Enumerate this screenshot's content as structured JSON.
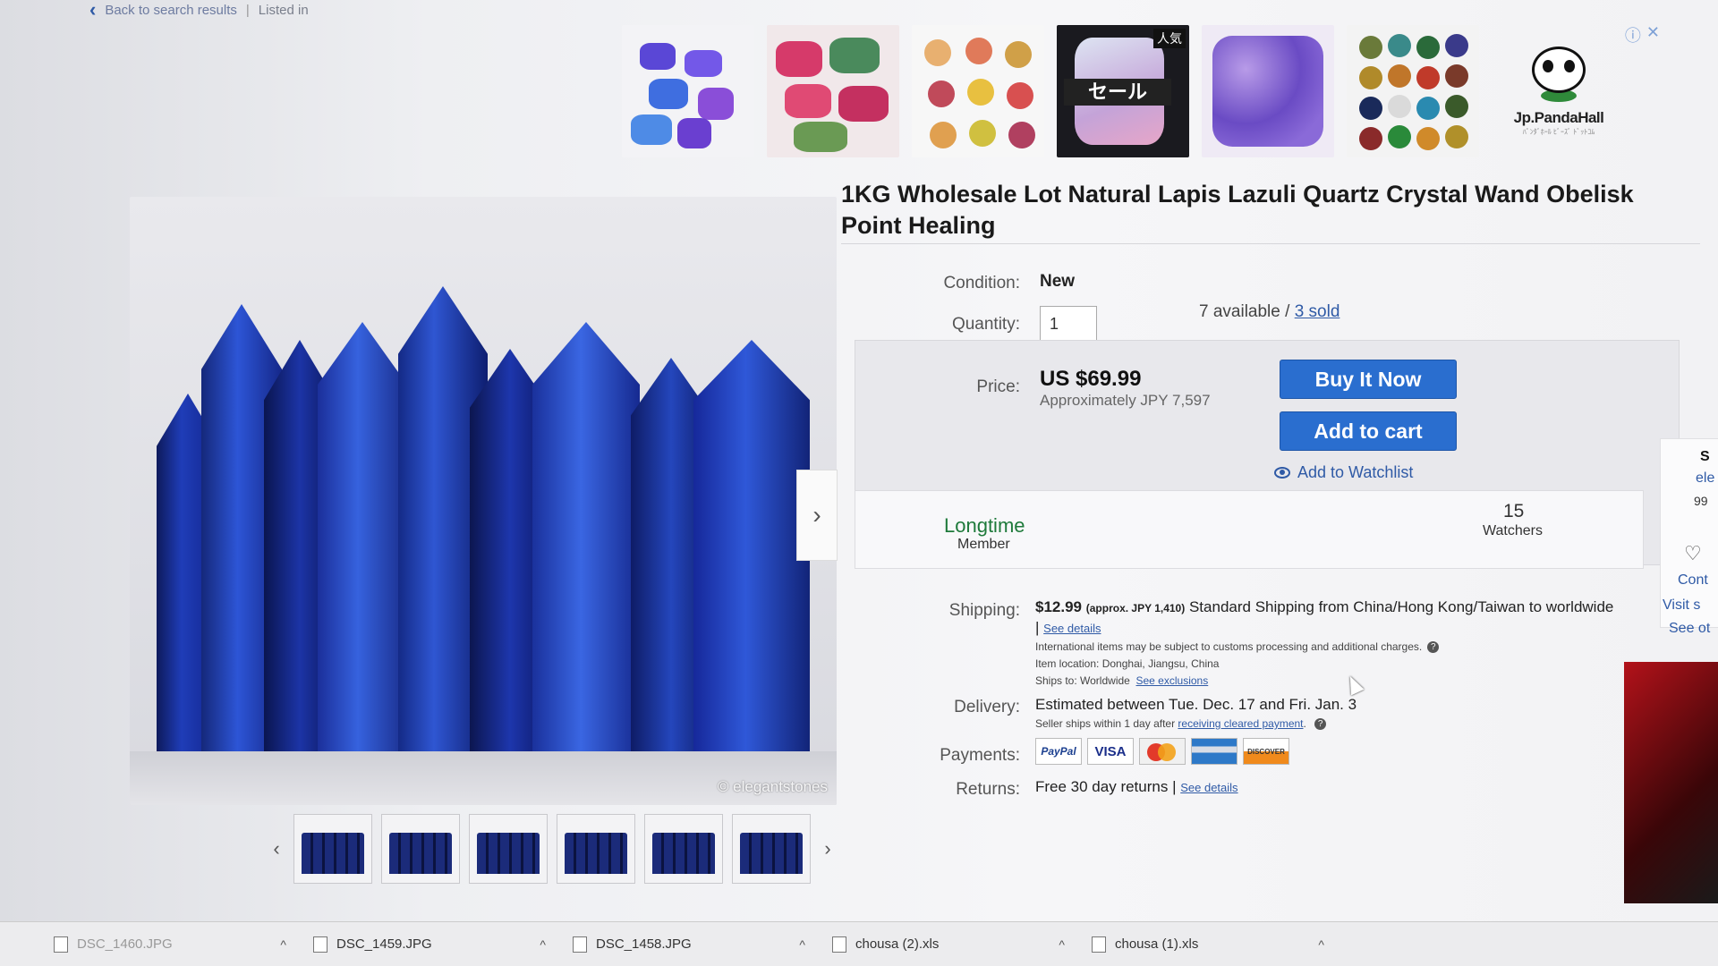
{
  "topbar": {
    "back_label": "Back to search results",
    "separator": "|",
    "listed_label": "Listed in"
  },
  "banner": {
    "sale_text": "セール",
    "ninki_text": "人気",
    "brand_name": "Jp.PandaHall",
    "brand_sub": "ﾊﾟﾝﾀﾞﾎｰﾙ ﾋﾞｰｽﾞ ﾄﾞｯﾄｺﾑ",
    "info_icon": "ⓘ",
    "close_icon": "✕"
  },
  "listing": {
    "title": "1KG Wholesale Lot Natural Lapis Lazuli Quartz Crystal Wand Obelisk Point Healing",
    "condition_label": "Condition:",
    "condition_value": "New",
    "quantity_label": "Quantity:",
    "quantity_value": "1",
    "available_text": "7 available /",
    "sold_link": "3 sold",
    "price_label": "Price:",
    "price_value": "US $69.99",
    "price_approx": "Approximately JPY 7,597",
    "buy_now_label": "Buy It Now",
    "add_to_cart_label": "Add to cart",
    "watchlist_label": "Add to Watchlist",
    "badge_main": "Longtime",
    "badge_sub": "Member",
    "watchers_count": "15",
    "watchers_label": "Watchers"
  },
  "shipping": {
    "label": "Shipping:",
    "cost": "$12.99",
    "cost_approx": "(approx. JPY 1,410)",
    "service": "Standard Shipping from China/Hong Kong/Taiwan to worldwide |",
    "see_details": "See details",
    "customs_note": "International items may be subject to customs processing and additional charges.",
    "location": "Item location:  Donghai, Jiangsu, China",
    "ships_to": "Ships to:  Worldwide",
    "see_exclusions": "See exclusions"
  },
  "delivery": {
    "label": "Delivery:",
    "estimate": "Estimated between Tue. Dec. 17 and Fri. Jan. 3",
    "note": "Seller ships within 1 day after",
    "note_link": "receiving cleared payment",
    "note_end": "."
  },
  "payments": {
    "label": "Payments:",
    "paypal": "PayPal",
    "visa": "VISA",
    "discover": "DISCOVER"
  },
  "returns": {
    "label": "Returns:",
    "value": "Free 30 day returns |",
    "see_details": "See details"
  },
  "photo": {
    "watermark": "© elegantstones"
  },
  "right_rail": {
    "s": "S",
    "ele": "ele",
    "n99": "99",
    "cont": "Cont",
    "visit": "Visit s",
    "see": "See ot"
  },
  "downloads": [
    {
      "name": "DSC_1460.JPG"
    },
    {
      "name": "DSC_1459.JPG"
    },
    {
      "name": "DSC_1458.JPG"
    },
    {
      "name": "chousa (2).xls"
    },
    {
      "name": "chousa (1).xls"
    }
  ],
  "colors": {
    "button_blue": "#2a6ecf",
    "link_blue": "#2f5aa6",
    "badge_green": "#1e7a3a",
    "lapis": "#1b2fa8"
  }
}
